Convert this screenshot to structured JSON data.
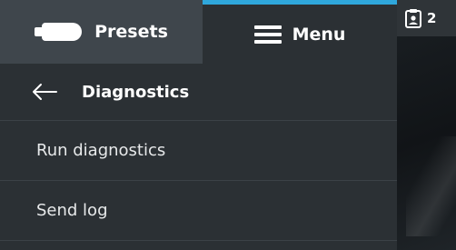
{
  "tabs": {
    "presets_label": "Presets",
    "presets_icon": "transducer-icon",
    "menu_label": "Menu",
    "menu_icon": "hamburger-icon",
    "active_tab": "Menu",
    "active_indicator_color": "#2fa7dc"
  },
  "breadcrumb": {
    "back_icon": "arrow-left-icon",
    "title": "Diagnostics"
  },
  "menu_items": [
    {
      "label": "Run diagnostics"
    },
    {
      "label": "Send log"
    }
  ],
  "side_indicator": {
    "icon": "clipboard-person-icon",
    "count": "2"
  }
}
